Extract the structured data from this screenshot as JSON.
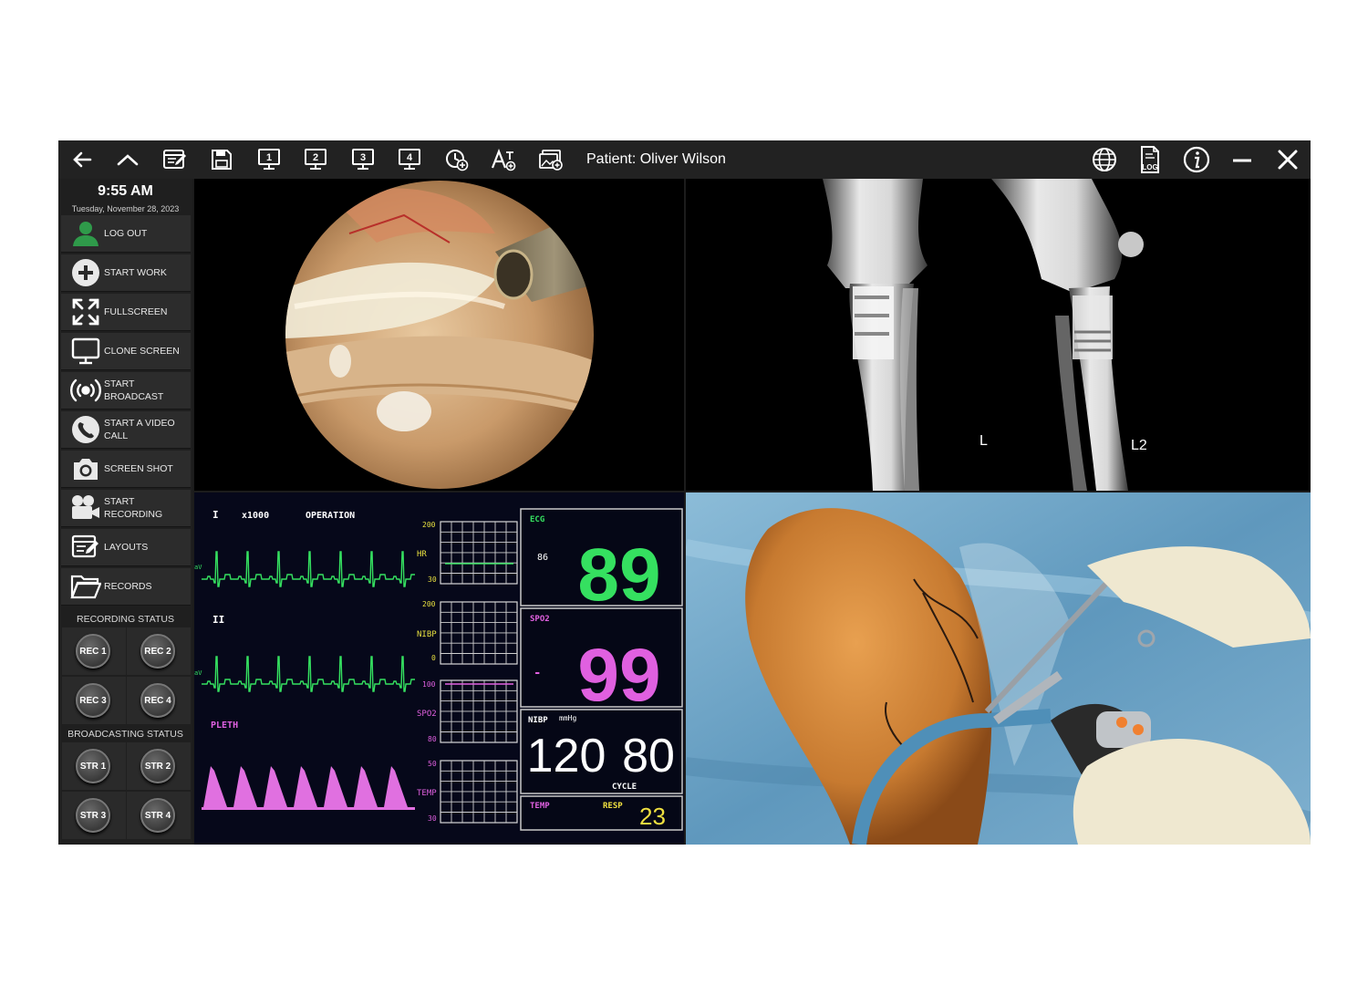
{
  "header": {
    "patient_label": "Patient: Oliver Wilson"
  },
  "toolbar": {
    "left_icons": [
      "back-arrow-icon",
      "up-chevron-icon",
      "edit-layout-icon",
      "save-icon",
      "screen-1-icon",
      "screen-2-icon",
      "screen-3-icon",
      "screen-4-icon",
      "add-timer-icon",
      "text-size-icon",
      "add-image-icon"
    ],
    "screen_numbers": [
      "1",
      "2",
      "3",
      "4"
    ],
    "right_icons": [
      "globe-icon",
      "log-file-icon",
      "info-icon",
      "minimize-icon",
      "close-icon"
    ],
    "log_label": "LOG"
  },
  "sidebar": {
    "time": "9:55 AM",
    "date": "Tuesday, November 28, 2023",
    "items": [
      {
        "label": "LOG OUT",
        "icon": "user-icon"
      },
      {
        "label": "START WORK",
        "icon": "plus-circle-icon"
      },
      {
        "label": "FULLSCREEN",
        "icon": "expand-icon"
      },
      {
        "label": "CLONE SCREEN",
        "icon": "monitor-icon"
      },
      {
        "label": "START BROADCAST",
        "icon": "broadcast-icon"
      },
      {
        "label": "START A VIDEO CALL",
        "icon": "phone-icon"
      },
      {
        "label": "SCREEN SHOT",
        "icon": "camera-icon"
      },
      {
        "label": "START RECORDING",
        "icon": "video-camera-icon"
      },
      {
        "label": "LAYOUTS",
        "icon": "layout-icon"
      },
      {
        "label": "RECORDS",
        "icon": "folder-icon"
      }
    ],
    "recording_status": {
      "title": "RECORDING STATUS",
      "buttons": [
        "REC 1",
        "REC 2",
        "REC 3",
        "REC 4"
      ]
    },
    "broadcasting_status": {
      "title": "BROADCASTING STATUS",
      "buttons": [
        "STR 1",
        "STR 2",
        "STR 3",
        "STR 4"
      ]
    }
  },
  "xray": {
    "labels": [
      "L",
      "L2"
    ]
  },
  "monitor": {
    "lead_1": "I",
    "gain": "x1000",
    "mode": "OPERATION",
    "lead_2": "II",
    "pleth": "PLETH",
    "lead_marks": [
      "aV",
      "aV"
    ],
    "trend_labels": {
      "hr": "HR",
      "hr_top": "200",
      "hr_bot": "30",
      "nibp": "NIBP",
      "nibp_top": "200",
      "nibp_bot": "0",
      "spo2": "SPO2",
      "spo2_top": "100",
      "spo2_bot": "80",
      "temp": "TEMP",
      "temp_top": "50",
      "temp_bot": "30"
    },
    "ecg_label": "ECG",
    "ecg_small": "86",
    "ecg_value": "89",
    "spo2_label": "SPO2",
    "spo2_small": "-",
    "spo2_value": "99",
    "nibp_label": "NIBP",
    "nibp_unit": "mmHg",
    "nibp_sys": "120",
    "nibp_dia": "80",
    "cycle_label": "CYCLE",
    "temp_label": "TEMP",
    "resp_label": "RESP",
    "resp_value": "23",
    "colors": {
      "ecg": "#35e060",
      "spo2": "#e060e0",
      "resp": "#f0e040",
      "grid": "#d8d8d8"
    }
  }
}
